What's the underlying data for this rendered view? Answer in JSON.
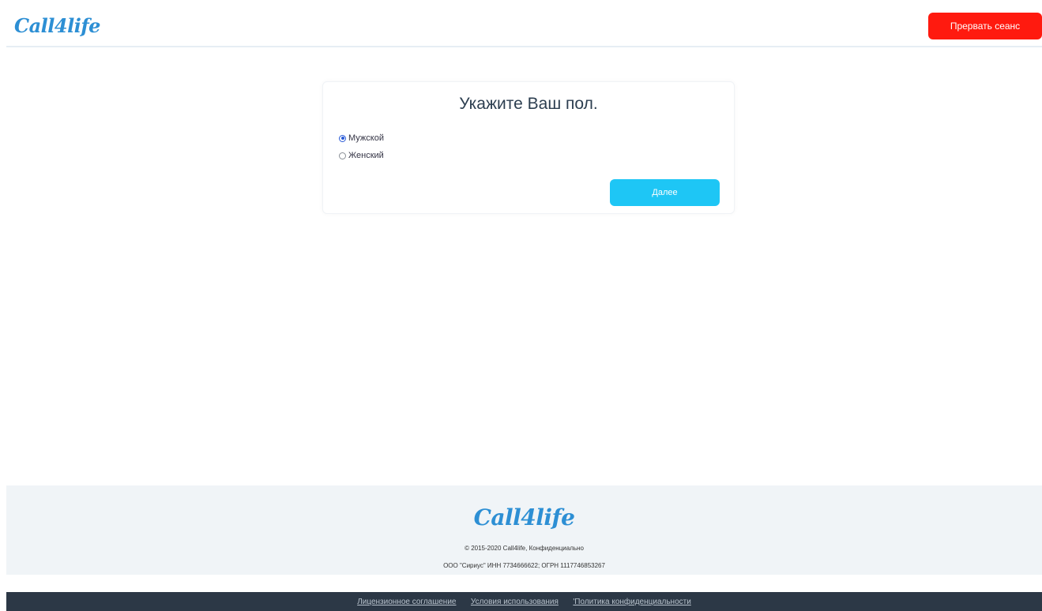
{
  "header": {
    "logo": "Call4life",
    "end_session_label": "Прервать сеанс"
  },
  "card": {
    "title": "Укажите Ваш пол.",
    "options": [
      {
        "label": "Мужской",
        "checked": true
      },
      {
        "label": "Женский",
        "checked": false
      }
    ],
    "next_label": "Далее"
  },
  "footer": {
    "logo": "Call4life",
    "copyright": "© 2015-2020 Call4life, Конфиденциально",
    "company": "ООО \"Сириус\" ИНН 7734666622; ОГРН 1117746853267"
  },
  "bottom_links": [
    "Лицензионное соглашение",
    "Условия использования",
    "'Политика конфиденциальности"
  ],
  "colors": {
    "brand": "#2d8fd4",
    "end_session": "#ff1a0f",
    "next_button": "#1ec6f5",
    "footer_bg": "#f0f4f7",
    "bottombar_bg": "#2c3846"
  }
}
